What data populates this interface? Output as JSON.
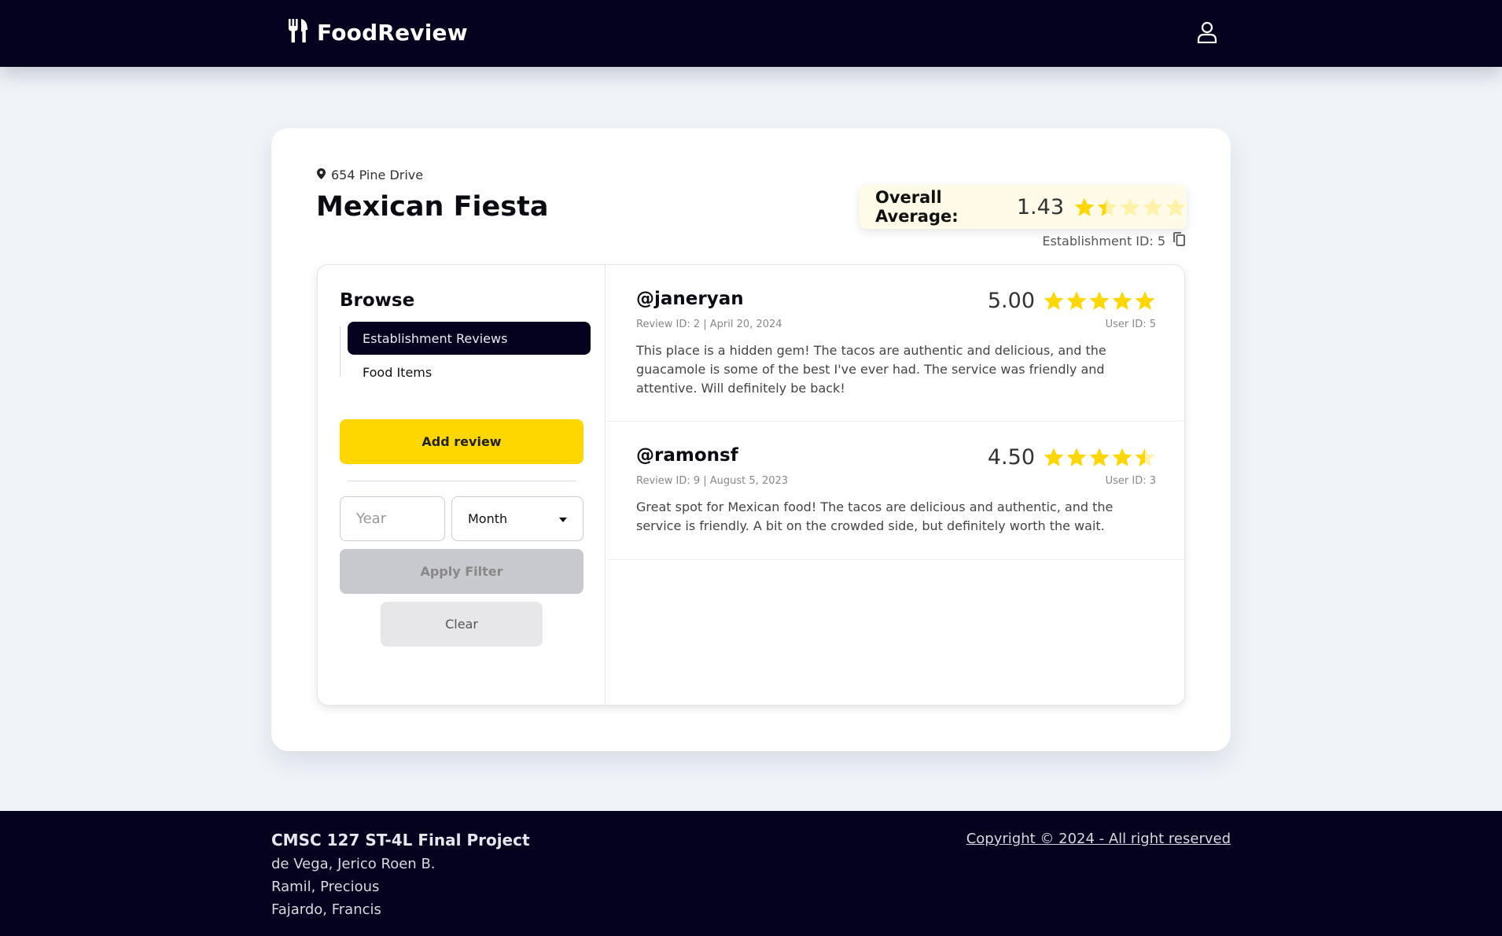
{
  "header": {
    "app_name": "FoodReview",
    "logo_icon": "utensils-icon",
    "profile_icon": "user-icon"
  },
  "establishment": {
    "address": "654 Pine Drive",
    "name": "Mexican Fiesta",
    "average_label": "Overall Average:",
    "average_value": "1.43",
    "average_rating": 1.43,
    "id_text": "Establishment ID: 5"
  },
  "sidebar": {
    "title": "Browse",
    "items": [
      {
        "label": "Establishment Reviews",
        "active": true
      },
      {
        "label": "Food Items",
        "active": false
      }
    ],
    "add_review_label": "Add review",
    "year_placeholder": "Year",
    "month_value": "Month",
    "apply_label": "Apply Filter",
    "clear_label": "Clear"
  },
  "reviews": [
    {
      "user": "@janeryan",
      "meta": "Review ID: 2 | April 20, 2024",
      "score": "5.00",
      "rating": 5.0,
      "user_id": "User ID: 5",
      "body": "This place is a hidden gem! The tacos are authentic and delicious, and the guacamole is some of the best I've ever had. The service was friendly and attentive. Will definitely be back!"
    },
    {
      "user": "@ramonsf",
      "meta": "Review ID: 9 | August 5, 2023",
      "score": "4.50",
      "rating": 4.5,
      "user_id": "User ID: 3",
      "body": "Great spot for Mexican food! The tacos are delicious and authentic, and the service is friendly. A bit on the crowded side, but definitely worth the wait."
    }
  ],
  "footer": {
    "title": "CMSC 127 ST-4L Final Project",
    "members": [
      "de Vega, Jerico Roen B.",
      "Ramil, Precious",
      "Fajardo, Francis"
    ],
    "copyright": "Copyright © 2024 - All right reserved"
  },
  "colors": {
    "navy": "#04021f",
    "star": "#ffd700",
    "star_empty": "#fff1a8"
  }
}
